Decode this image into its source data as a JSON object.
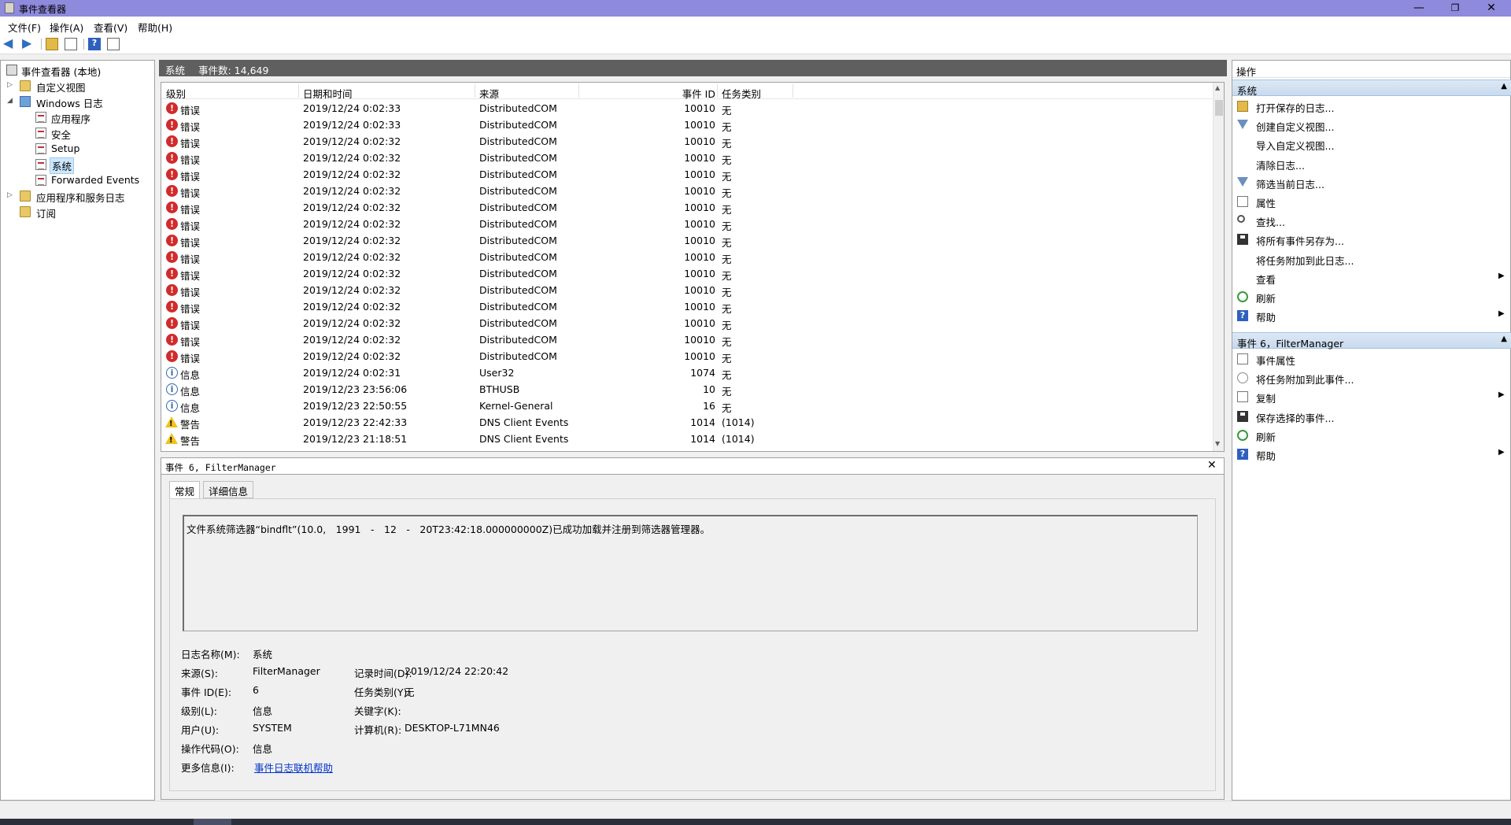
{
  "window": {
    "title": "事件查看器",
    "controls": {
      "minimize": "—",
      "maximize": "❐",
      "close": "✕"
    }
  },
  "menu": [
    "文件(F)",
    "操作(A)",
    "查看(V)",
    "帮助(H)"
  ],
  "tree": {
    "root": "事件查看器 (本地)",
    "custom_views": "自定义视图",
    "windows_logs": "Windows 日志",
    "logs": [
      "应用程序",
      "安全",
      "Setup",
      "系统",
      "Forwarded Events"
    ],
    "selected_log": "系统",
    "app_service_logs": "应用程序和服务日志",
    "subscriptions": "订阅"
  },
  "center": {
    "log_name": "系统",
    "event_count": "事件数: 14,649"
  },
  "event_list": {
    "columns": {
      "level": "级别",
      "datetime": "日期和时间",
      "source": "来源",
      "event_id": "事件 ID",
      "task": "任务类别"
    },
    "rows": [
      {
        "type": "error",
        "level": "错误",
        "datetime": "2019/12/24 0:02:33",
        "source": "DistributedCOM",
        "event_id": "10010",
        "task": "无"
      },
      {
        "type": "error",
        "level": "错误",
        "datetime": "2019/12/24 0:02:33",
        "source": "DistributedCOM",
        "event_id": "10010",
        "task": "无"
      },
      {
        "type": "error",
        "level": "错误",
        "datetime": "2019/12/24 0:02:32",
        "source": "DistributedCOM",
        "event_id": "10010",
        "task": "无"
      },
      {
        "type": "error",
        "level": "错误",
        "datetime": "2019/12/24 0:02:32",
        "source": "DistributedCOM",
        "event_id": "10010",
        "task": "无"
      },
      {
        "type": "error",
        "level": "错误",
        "datetime": "2019/12/24 0:02:32",
        "source": "DistributedCOM",
        "event_id": "10010",
        "task": "无"
      },
      {
        "type": "error",
        "level": "错误",
        "datetime": "2019/12/24 0:02:32",
        "source": "DistributedCOM",
        "event_id": "10010",
        "task": "无"
      },
      {
        "type": "error",
        "level": "错误",
        "datetime": "2019/12/24 0:02:32",
        "source": "DistributedCOM",
        "event_id": "10010",
        "task": "无"
      },
      {
        "type": "error",
        "level": "错误",
        "datetime": "2019/12/24 0:02:32",
        "source": "DistributedCOM",
        "event_id": "10010",
        "task": "无"
      },
      {
        "type": "error",
        "level": "错误",
        "datetime": "2019/12/24 0:02:32",
        "source": "DistributedCOM",
        "event_id": "10010",
        "task": "无"
      },
      {
        "type": "error",
        "level": "错误",
        "datetime": "2019/12/24 0:02:32",
        "source": "DistributedCOM",
        "event_id": "10010",
        "task": "无"
      },
      {
        "type": "error",
        "level": "错误",
        "datetime": "2019/12/24 0:02:32",
        "source": "DistributedCOM",
        "event_id": "10010",
        "task": "无"
      },
      {
        "type": "error",
        "level": "错误",
        "datetime": "2019/12/24 0:02:32",
        "source": "DistributedCOM",
        "event_id": "10010",
        "task": "无"
      },
      {
        "type": "error",
        "level": "错误",
        "datetime": "2019/12/24 0:02:32",
        "source": "DistributedCOM",
        "event_id": "10010",
        "task": "无"
      },
      {
        "type": "error",
        "level": "错误",
        "datetime": "2019/12/24 0:02:32",
        "source": "DistributedCOM",
        "event_id": "10010",
        "task": "无"
      },
      {
        "type": "error",
        "level": "错误",
        "datetime": "2019/12/24 0:02:32",
        "source": "DistributedCOM",
        "event_id": "10010",
        "task": "无"
      },
      {
        "type": "error",
        "level": "错误",
        "datetime": "2019/12/24 0:02:32",
        "source": "DistributedCOM",
        "event_id": "10010",
        "task": "无"
      },
      {
        "type": "info",
        "level": "信息",
        "datetime": "2019/12/24 0:02:31",
        "source": "User32",
        "event_id": "1074",
        "task": "无"
      },
      {
        "type": "info",
        "level": "信息",
        "datetime": "2019/12/23 23:56:06",
        "source": "BTHUSB",
        "event_id": "10",
        "task": "无"
      },
      {
        "type": "info",
        "level": "信息",
        "datetime": "2019/12/23 22:50:55",
        "source": "Kernel-General",
        "event_id": "16",
        "task": "无"
      },
      {
        "type": "warning",
        "level": "警告",
        "datetime": "2019/12/23 22:42:33",
        "source": "DNS Client Events",
        "event_id": "1014",
        "task": "(1014)"
      },
      {
        "type": "warning",
        "level": "警告",
        "datetime": "2019/12/23 21:18:51",
        "source": "DNS Client Events",
        "event_id": "1014",
        "task": "(1014)"
      }
    ]
  },
  "detail": {
    "header": "事件 6, FilterManager",
    "tabs": [
      "常规",
      "详细信息"
    ],
    "message": "文件系统筛选器“bindflt”(10.0,　1991　-　12　-　20T23:42:18.000000000Z)已成功加载并注册到筛选器管理器。",
    "fields": {
      "log_name_label": "日志名称(M):",
      "log_name": "系统",
      "source_label": "来源(S):",
      "source": "FilterManager",
      "logged_label": "记录时间(D):",
      "logged": "2019/12/24 22:20:42",
      "event_id_label": "事件 ID(E):",
      "event_id": "6",
      "task_label": "任务类别(Y):",
      "task": "无",
      "level_label": "级别(L):",
      "level": "信息",
      "keywords_label": "关键字(K):",
      "keywords": "",
      "user_label": "用户(U):",
      "user": "SYSTEM",
      "computer_label": "计算机(R):",
      "computer": "DESKTOP-L71MN46",
      "opcode_label": "操作代码(O):",
      "opcode": "信息",
      "more_info_label": "更多信息(I):",
      "more_info_link": "事件日志联机帮助"
    }
  },
  "actions": {
    "title": "操作",
    "section1": "系统",
    "items1": [
      {
        "label": "打开保存的日志...",
        "icon": "folder-open-icon",
        "arrow": false
      },
      {
        "label": "创建自定义视图...",
        "icon": "filter-icon",
        "arrow": false
      },
      {
        "label": "导入自定义视图...",
        "icon": "",
        "arrow": false
      },
      {
        "label": "清除日志...",
        "icon": "",
        "arrow": false
      },
      {
        "label": "筛选当前日志...",
        "icon": "filter-icon",
        "arrow": false
      },
      {
        "label": "属性",
        "icon": "properties-icon",
        "arrow": false
      },
      {
        "label": "查找...",
        "icon": "find-icon",
        "arrow": false
      },
      {
        "label": "将所有事件另存为...",
        "icon": "save-icon",
        "arrow": false
      },
      {
        "label": "将任务附加到此日志...",
        "icon": "",
        "arrow": false
      },
      {
        "label": "查看",
        "icon": "",
        "arrow": true
      },
      {
        "label": "刷新",
        "icon": "refresh-icon",
        "arrow": false
      },
      {
        "label": "帮助",
        "icon": "help-icon",
        "arrow": true
      }
    ],
    "section2": "事件 6，FilterManager",
    "items2": [
      {
        "label": "事件属性",
        "icon": "properties-icon",
        "arrow": false
      },
      {
        "label": "将任务附加到此事件...",
        "icon": "task-icon",
        "arrow": false
      },
      {
        "label": "复制",
        "icon": "copy-icon",
        "arrow": true
      },
      {
        "label": "保存选择的事件...",
        "icon": "save-icon",
        "arrow": false
      },
      {
        "label": "刷新",
        "icon": "refresh-icon",
        "arrow": false
      },
      {
        "label": "帮助",
        "icon": "help-icon",
        "arrow": true
      }
    ]
  },
  "colors": {
    "titlebar": "#8e8adc",
    "header_bar": "#5f5f5f",
    "error": "#d12b2b",
    "warning": "#f3c21a",
    "info": "#3067b0",
    "link": "#0033cc"
  }
}
